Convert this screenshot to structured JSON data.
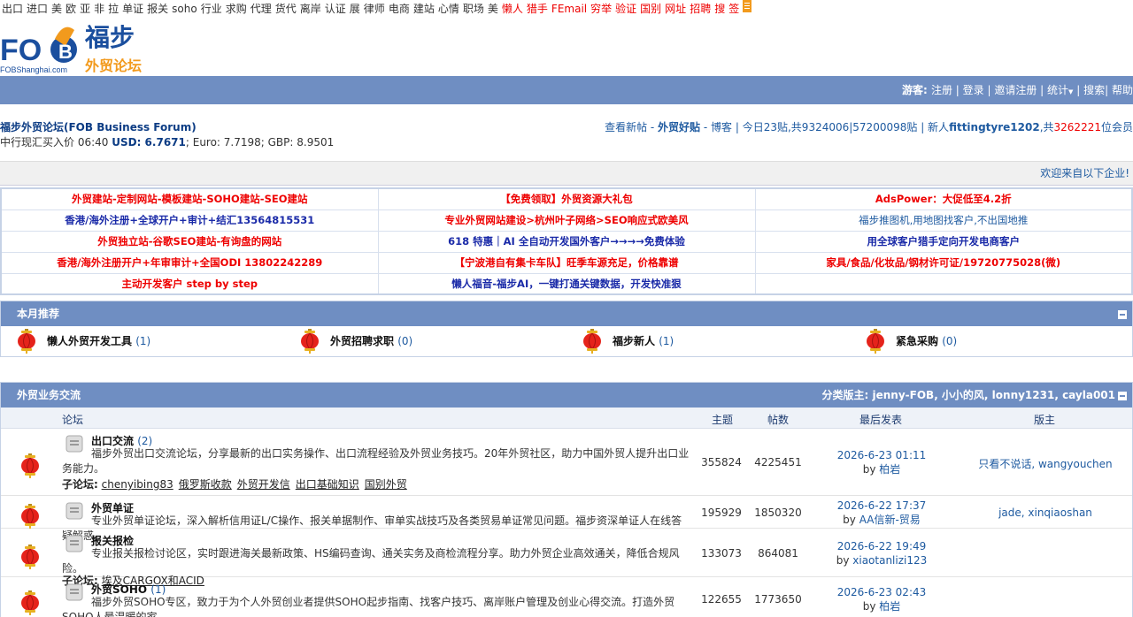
{
  "topnav": {
    "items": [
      "出口",
      "进口",
      "美",
      "欧",
      "亚",
      "非",
      "拉",
      "单证",
      "报关",
      "soho",
      "行业",
      "求购",
      "代理",
      "货代",
      "离岸",
      "认证",
      "展",
      "律师",
      "电商",
      "建站",
      "心情",
      "职场",
      "美"
    ],
    "red_items": [
      "懒人",
      "猎手",
      "FEmail",
      "穷举",
      "验证",
      "国别",
      "网址",
      "招聘",
      "搜",
      "签"
    ]
  },
  "logo": {
    "text": "FOB",
    "sub": "FOBShanghai.com",
    "name_cn": "福步",
    "forum_cn": "外贸论坛"
  },
  "bluebar": {
    "guest": "游客:",
    "register": "注册",
    "login": "登录",
    "invite": "邀请注册",
    "stats": "统计",
    "search": "搜索",
    "help": "帮助"
  },
  "info": {
    "forum_name": "福步外贸论坛(FOB Business Forum)",
    "rates_prefix": "中行现汇买入价 06:40",
    "usd_label": "USD: 6.7671",
    "rates_rest": "; Euro: 7.7198; GBP: 8.9501",
    "right_new": "查看新帖",
    "right_good": "外贸好贴",
    "right_blog": "博客",
    "right_today": "今日23贴,共9324006|57200098贴",
    "right_newuser_prefix": "新人",
    "right_newuser": "fittingtyre1202",
    "right_count_prefix": ",共",
    "right_count": "3262221",
    "right_count_suffix": "位会员"
  },
  "welcome": "欢迎来自以下企业!",
  "ads": [
    [
      "外贸建站-定制网站-模板建站-SOHO建站-SEO建站",
      "【免费领取】外贸资源大礼包",
      "AdsPower：大促低至4.2折"
    ],
    [
      "香港/海外注册+全球开户+审计+结汇13564815531",
      "专业外贸网站建设>杭州叶子网络>SEO响应式欧美风",
      "福步推图机,用地图找客户,不出国地推"
    ],
    [
      "外贸独立站-谷歌SEO建站-有询盘的网站",
      "618 特惠｜AI 全自动开发国外客户→→→→免费体验",
      "用全球客户猎手定向开发电商客户"
    ],
    [
      "香港/海外注册开户+年审审计+全国ODI 13802242289",
      "【宁波港自有集卡车队】旺季车源充足，价格靠谱",
      "家具/食品/化妆品/钢材许可证/19720775028(微)"
    ],
    [
      "主动开发客户 step by step",
      "懒人福音-福步AI，一键打通关键数据，开发快准狠",
      ""
    ]
  ],
  "monthly": {
    "title": "本月推荐",
    "items": [
      {
        "name": "懒人外贸开发工具",
        "count": "(1)"
      },
      {
        "name": "外贸招聘求职",
        "count": "(0)"
      },
      {
        "name": "福步新人",
        "count": "(1)"
      },
      {
        "name": "紧急采购",
        "count": "(0)"
      }
    ]
  },
  "category": {
    "title": "外贸业务交流",
    "moderators": "分类版主: jenny-FOB, 小小的风, lonny1231, cayla001",
    "columns": {
      "forum": "论坛",
      "topics": "主题",
      "posts": "帖数",
      "last": "最后发表",
      "mods": "版主"
    },
    "sub_label": "子论坛:",
    "forums": [
      {
        "title": "出口交流",
        "count": "(2)",
        "desc": "福步外贸出口交流论坛，分享最新的出口实务操作、出口流程经验及外贸业务技巧。20年外贸社区，助力中国外贸人提升出口业务能力。",
        "subs": [
          "chenyibing83",
          "俄罗斯收款",
          "外贸开发信",
          "出口基础知识",
          "国别外贸"
        ],
        "topics": "355824",
        "posts": "4225451",
        "last_time": "2026-6-23 01:11",
        "last_by": "by",
        "last_user": "柏岩",
        "mods": "只看不说话, wangyouchen"
      },
      {
        "title": "外贸单证",
        "count": "",
        "desc": "专业外贸单证论坛，深入解析信用证L/C操作、报关单据制作、审单实战技巧及各类贸易单证常见问题。福步资深单证人在线答疑解惑。",
        "subs": [],
        "topics": "195929",
        "posts": "1850320",
        "last_time": "2026-6-22 17:37",
        "last_by": "by",
        "last_user": "AA信新-贸易",
        "mods": "jade, xinqiaoshan"
      },
      {
        "title": "报关报检",
        "count": "",
        "desc": "专业报关报检讨论区，实时跟进海关最新政策、HS编码查询、通关实务及商检流程分享。助力外贸企业高效通关，降低合规风险。",
        "subs": [
          "埃及CARGOX和ACID"
        ],
        "topics": "133073",
        "posts": "864081",
        "last_time": "2026-6-22 19:49",
        "last_by": "by",
        "last_user": "xiaotanlizi123",
        "mods": ""
      },
      {
        "title": "外贸SOHO",
        "count": "(1)",
        "desc": "福步外贸SOHO专区，致力于为个人外贸创业者提供SOHO起步指南、找客户技巧、离岸账户管理及创业心得交流。打造外贸SOHO人最温暖的家。",
        "subs": [],
        "topics": "122655",
        "posts": "1773650",
        "last_time": "2026-6-23 02:43",
        "last_by": "by",
        "last_user": "柏岩",
        "mods": ""
      }
    ]
  }
}
